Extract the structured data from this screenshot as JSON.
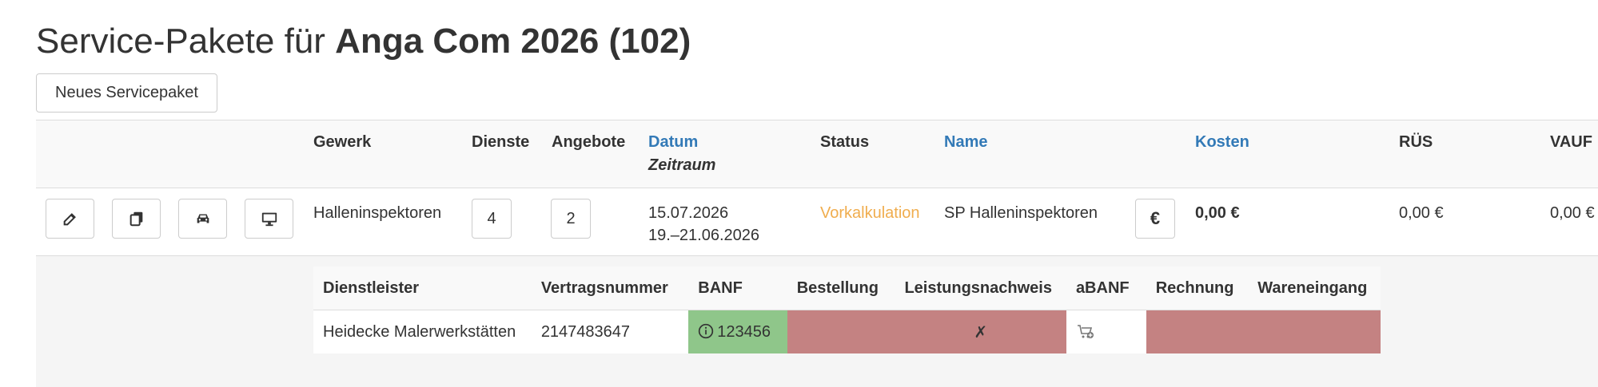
{
  "page": {
    "title_prefix": "Service-Pakete für",
    "title_event": "Anga Com 2026 (102)"
  },
  "toolbar": {
    "new_label": "Neues Servicepaket"
  },
  "table": {
    "headers": {
      "gewerk": "Gewerk",
      "dienste": "Dienste",
      "angebote": "Angebote",
      "datum": "Datum",
      "zeitraum": "Zeitraum",
      "status": "Status",
      "name": "Name",
      "kosten": "Kosten",
      "rues": "RÜS",
      "vauf": "VAUF"
    },
    "row": {
      "gewerk": "Halleninspektoren",
      "dienste": "4",
      "angebote": "2",
      "datum": "15.07.2026",
      "zeitraum": "19.–21.06.2026",
      "status": "Vorkalkulation",
      "name": "SP Halleninspektoren",
      "euro_icon_label": "€",
      "kosten": "0,00 €",
      "rues": "0,00 €",
      "vauf": "0,00 €"
    }
  },
  "subtable": {
    "headers": {
      "dienstleister": "Dienstleister",
      "vertragsnummer": "Vertragsnummer",
      "banf": "BANF",
      "bestellung": "Bestellung",
      "leistungsnachweis": "Leistungsnachweis",
      "abanf": "aBANF",
      "rechnung": "Rechnung",
      "wareneingang": "Wareneingang"
    },
    "row": {
      "dienstleister": "Heidecke Malerwerkstätten",
      "vertragsnummer": "2147483647",
      "banf": "123456",
      "leistungsnachweis_mark": "✗"
    }
  },
  "colors": {
    "link": "#337ab7",
    "status": "#f0ad4e",
    "green_cell": "#8fc68a",
    "red_cell": "#c48282"
  },
  "icons": [
    "edit-icon",
    "copy-icon",
    "car-icon",
    "monitor-icon",
    "euro-icon",
    "info-icon",
    "cart-plus-icon"
  ]
}
